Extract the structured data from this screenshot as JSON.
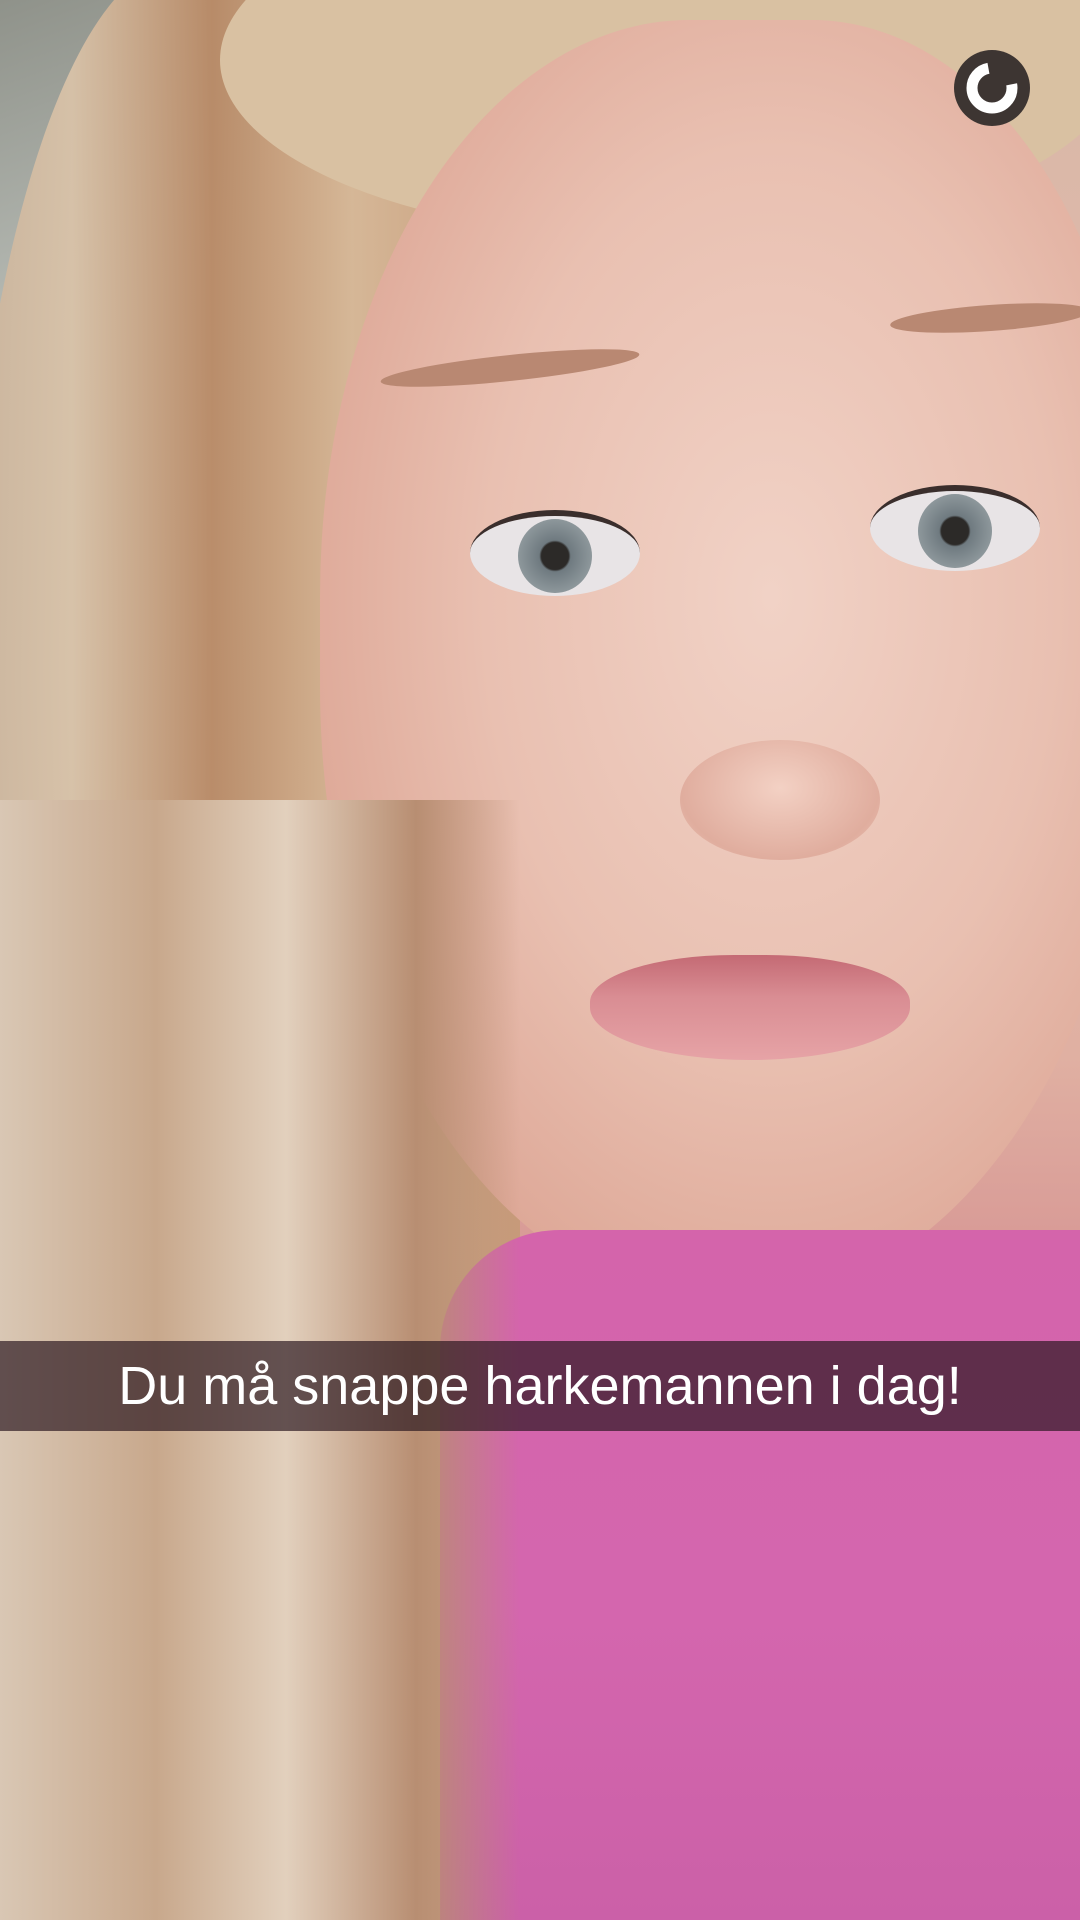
{
  "snap": {
    "caption": "Du må snappe harkemannen i dag!",
    "timer_icon": "timer-ring-icon",
    "timer_remaining_fraction": 0.75
  },
  "colors": {
    "caption_bar": "#28141e",
    "timer_bg": "#3d3532",
    "timer_ring": "#ffffff"
  }
}
